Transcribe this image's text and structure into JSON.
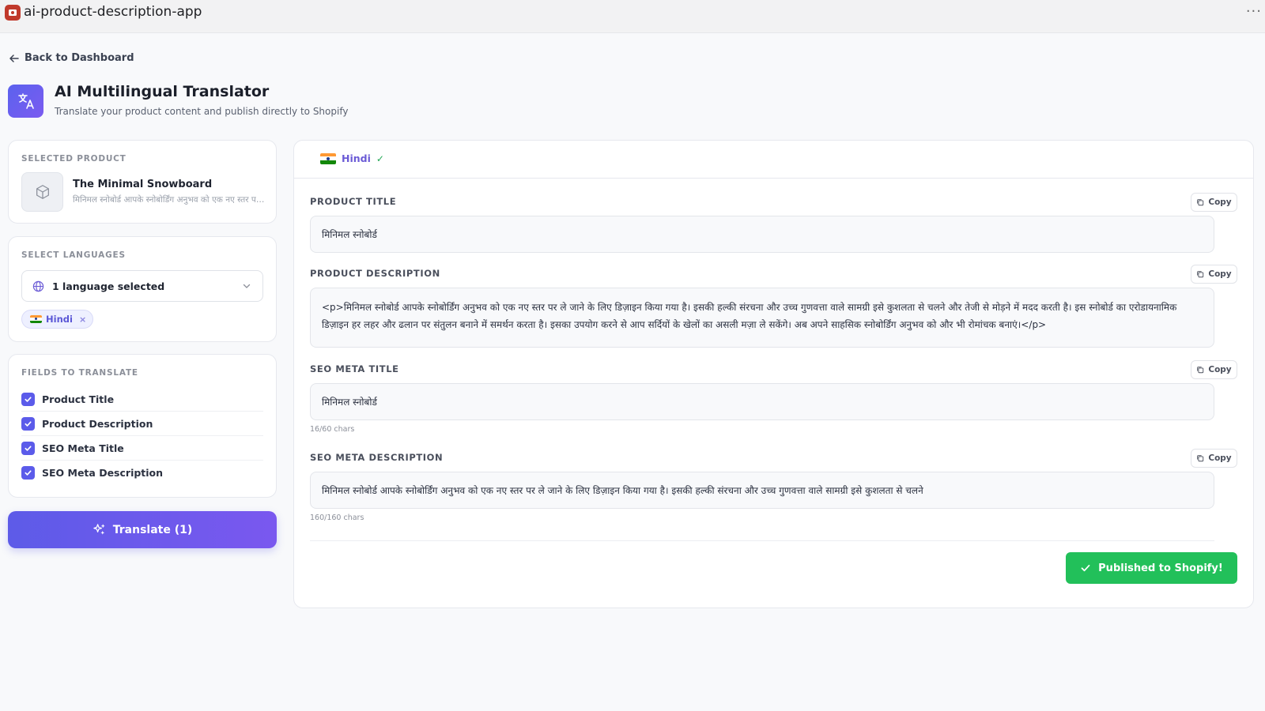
{
  "app": {
    "title": "ai-product-description-app",
    "more": "···"
  },
  "nav": {
    "back_label": "Back to Dashboard"
  },
  "header": {
    "title": "AI Multilingual Translator",
    "subtitle": "Translate your product content and publish directly to Shopify"
  },
  "selected_product": {
    "section_label": "SELECTED PRODUCT",
    "name": "The Minimal Snowboard",
    "excerpt": "मिनिमल स्नोबोर्ड आपके स्नोबोर्डिंग अनुभव को एक नए स्तर पर ले जाने के लिए डिज़ाइन किया गया है।"
  },
  "languages": {
    "section_label": "SELECT LANGUAGES",
    "select_text": "1 language selected",
    "chips": [
      {
        "label": "Hindi",
        "remove": "×"
      }
    ]
  },
  "fields": {
    "section_label": "FIELDS TO TRANSLATE",
    "items": [
      {
        "label": "Product Title",
        "checked": true
      },
      {
        "label": "Product Description",
        "checked": true
      },
      {
        "label": "SEO Meta Title",
        "checked": true
      },
      {
        "label": "SEO Meta Description",
        "checked": true
      }
    ]
  },
  "translate_button": {
    "label": "Translate (1)"
  },
  "results": {
    "active_tab": {
      "label": "Hindi",
      "check": "✓"
    },
    "copy_label": "Copy",
    "product_title": {
      "label": "PRODUCT TITLE",
      "value": "मिनिमल स्नोबोर्ड"
    },
    "product_description": {
      "label": "PRODUCT DESCRIPTION",
      "value": "<p>मिनिमल स्नोबोर्ड आपके स्नोबोर्डिंग अनुभव को एक नए स्तर पर ले जाने के लिए डिज़ाइन किया गया है। इसकी हल्की संरचना और उच्च गुणवत्ता वाले सामग्री इसे कुशलता से चलने और तेजी से मोड़ने में मदद करती है। इस स्नोबोर्ड का एरोडायनामिक डिज़ाइन हर लहर और ढलान पर संतुलन बनाने में समर्थन करता है। इसका उपयोग करने से आप सर्दियों के खेलों का असली मज़ा ले सकेंगे। अब अपने साहसिक स्नोबोर्डिंग अनुभव को और भी रोमांचक बनाएं।</p>"
    },
    "seo_meta_title": {
      "label": "SEO META TITLE",
      "value": "मिनिमल स्नोबोर्ड",
      "chars": "16/60 chars"
    },
    "seo_meta_description": {
      "label": "SEO META DESCRIPTION",
      "value": "मिनिमल स्नोबोर्ड आपके स्नोबोर्डिंग अनुभव को एक नए स्तर पर ले जाने के लिए डिज़ाइन किया गया है। इसकी हल्की संरचना और उच्च गुणवत्ता वाले सामग्री इसे कुशलता से चलने",
      "chars": "160/160 chars"
    },
    "publish_label": "Published to Shopify!"
  },
  "colors": {
    "accent": "#5d5be8",
    "success": "#22c05a",
    "app_logo": "#c0392b"
  }
}
